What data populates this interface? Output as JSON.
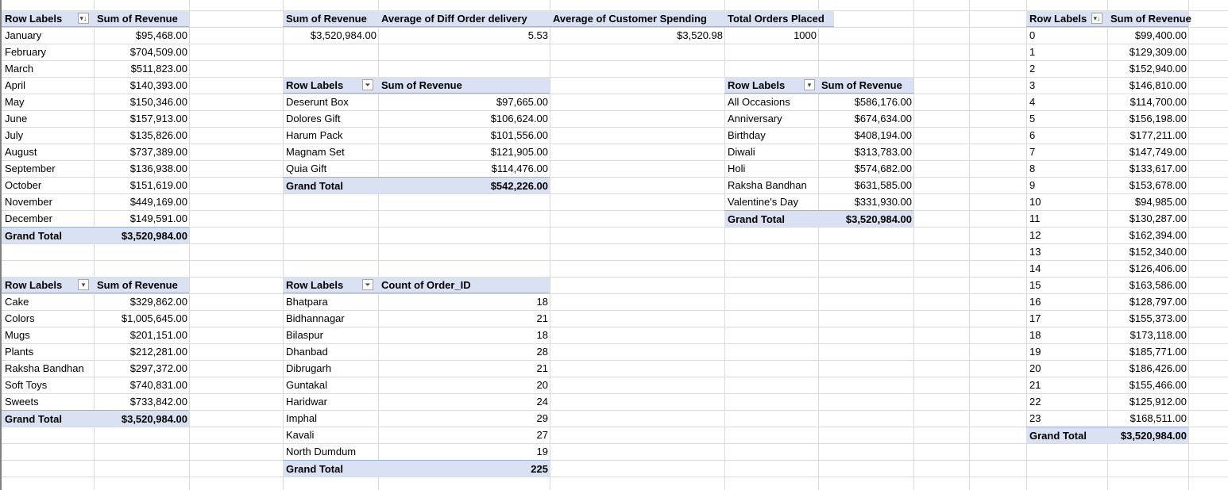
{
  "pivot_month": {
    "header": [
      "Row Labels",
      "Sum of Revenue"
    ],
    "rows": [
      [
        "January",
        "$95,468.00"
      ],
      [
        "February",
        "$704,509.00"
      ],
      [
        "March",
        "$511,823.00"
      ],
      [
        "April",
        "$140,393.00"
      ],
      [
        "May",
        "$150,346.00"
      ],
      [
        "June",
        "$157,913.00"
      ],
      [
        "July",
        "$135,826.00"
      ],
      [
        "August",
        "$737,389.00"
      ],
      [
        "September",
        "$136,938.00"
      ],
      [
        "October",
        "$151,619.00"
      ],
      [
        "November",
        "$449,169.00"
      ],
      [
        "December",
        "$149,591.00"
      ]
    ],
    "total": [
      "Grand Total",
      "$3,520,984.00"
    ],
    "filter_icon": "sort-desc-filter-icon"
  },
  "kpi": {
    "headers": [
      "Sum of Revenue",
      "Average of Diff Order delivery",
      "Average of Customer Spending",
      "Total Orders Placed"
    ],
    "values": [
      "$3,520,984.00",
      "5.53",
      "$3,520.98",
      "1000"
    ]
  },
  "pivot_product": {
    "header": [
      "Row Labels",
      "Sum of Revenue"
    ],
    "rows": [
      [
        "Deserunt Box",
        "$97,665.00"
      ],
      [
        "Dolores Gift",
        "$106,624.00"
      ],
      [
        "Harum Pack",
        "$101,556.00"
      ],
      [
        "Magnam Set",
        "$121,905.00"
      ],
      [
        "Quia Gift",
        "$114,476.00"
      ]
    ],
    "total": [
      "Grand Total",
      "$542,226.00"
    ],
    "filter_icon": "funnel-filter-icon"
  },
  "pivot_occasion": {
    "header": [
      "Row Labels",
      "Sum of Revenue"
    ],
    "rows": [
      [
        "All Occasions",
        "$586,176.00"
      ],
      [
        "Anniversary",
        "$674,634.00"
      ],
      [
        "Birthday",
        "$408,194.00"
      ],
      [
        "Diwali",
        "$313,783.00"
      ],
      [
        "Holi",
        "$574,682.00"
      ],
      [
        "Raksha Bandhan",
        "$631,585.00"
      ],
      [
        "Valentine's Day",
        "$331,930.00"
      ]
    ],
    "total": [
      "Grand Total",
      "$3,520,984.00"
    ],
    "filter_icon": "dropdown-icon"
  },
  "pivot_hour": {
    "header": [
      "Row Labels",
      "Sum of Revenue"
    ],
    "rows": [
      [
        "0",
        "$99,400.00"
      ],
      [
        "1",
        "$129,309.00"
      ],
      [
        "2",
        "$152,940.00"
      ],
      [
        "3",
        "$146,810.00"
      ],
      [
        "4",
        "$114,700.00"
      ],
      [
        "5",
        "$156,198.00"
      ],
      [
        "6",
        "$177,211.00"
      ],
      [
        "7",
        "$147,749.00"
      ],
      [
        "8",
        "$133,617.00"
      ],
      [
        "9",
        "$153,678.00"
      ],
      [
        "10",
        "$94,985.00"
      ],
      [
        "11",
        "$130,287.00"
      ],
      [
        "12",
        "$162,394.00"
      ],
      [
        "13",
        "$152,340.00"
      ],
      [
        "14",
        "$126,406.00"
      ],
      [
        "15",
        "$163,586.00"
      ],
      [
        "16",
        "$128,797.00"
      ],
      [
        "17",
        "$155,373.00"
      ],
      [
        "18",
        "$173,118.00"
      ],
      [
        "19",
        "$185,771.00"
      ],
      [
        "20",
        "$186,426.00"
      ],
      [
        "21",
        "$155,466.00"
      ],
      [
        "22",
        "$125,912.00"
      ],
      [
        "23",
        "$168,511.00"
      ]
    ],
    "total": [
      "Grand Total",
      "$3,520,984.00"
    ],
    "filter_icon": "sort-desc-filter-icon"
  },
  "pivot_category": {
    "header": [
      "Row Labels",
      "Sum of Revenue"
    ],
    "rows": [
      [
        "Cake",
        "$329,862.00"
      ],
      [
        "Colors",
        "$1,005,645.00"
      ],
      [
        "Mugs",
        "$201,151.00"
      ],
      [
        "Plants",
        "$212,281.00"
      ],
      [
        "Raksha Bandhan",
        "$297,372.00"
      ],
      [
        "Soft Toys",
        "$740,831.00"
      ],
      [
        "Sweets",
        "$733,842.00"
      ]
    ],
    "total": [
      "Grand Total",
      "$3,520,984.00"
    ],
    "filter_icon": "dropdown-icon"
  },
  "pivot_city": {
    "header": [
      "Row Labels",
      "Count of Order_ID"
    ],
    "rows": [
      [
        "Bhatpara",
        "18"
      ],
      [
        "Bidhannagar",
        "21"
      ],
      [
        "Bilaspur",
        "18"
      ],
      [
        "Dhanbad",
        "28"
      ],
      [
        "Dibrugarh",
        "21"
      ],
      [
        "Guntakal",
        "20"
      ],
      [
        "Haridwar",
        "24"
      ],
      [
        "Imphal",
        "29"
      ],
      [
        "Kavali",
        "27"
      ],
      [
        "North Dumdum",
        "19"
      ]
    ],
    "total": [
      "Grand Total",
      "225"
    ],
    "filter_icon": "funnel-filter-icon"
  },
  "icons": {
    "sort_desc": "▾↓",
    "funnel": "⏷",
    "dropdown": "▾"
  }
}
